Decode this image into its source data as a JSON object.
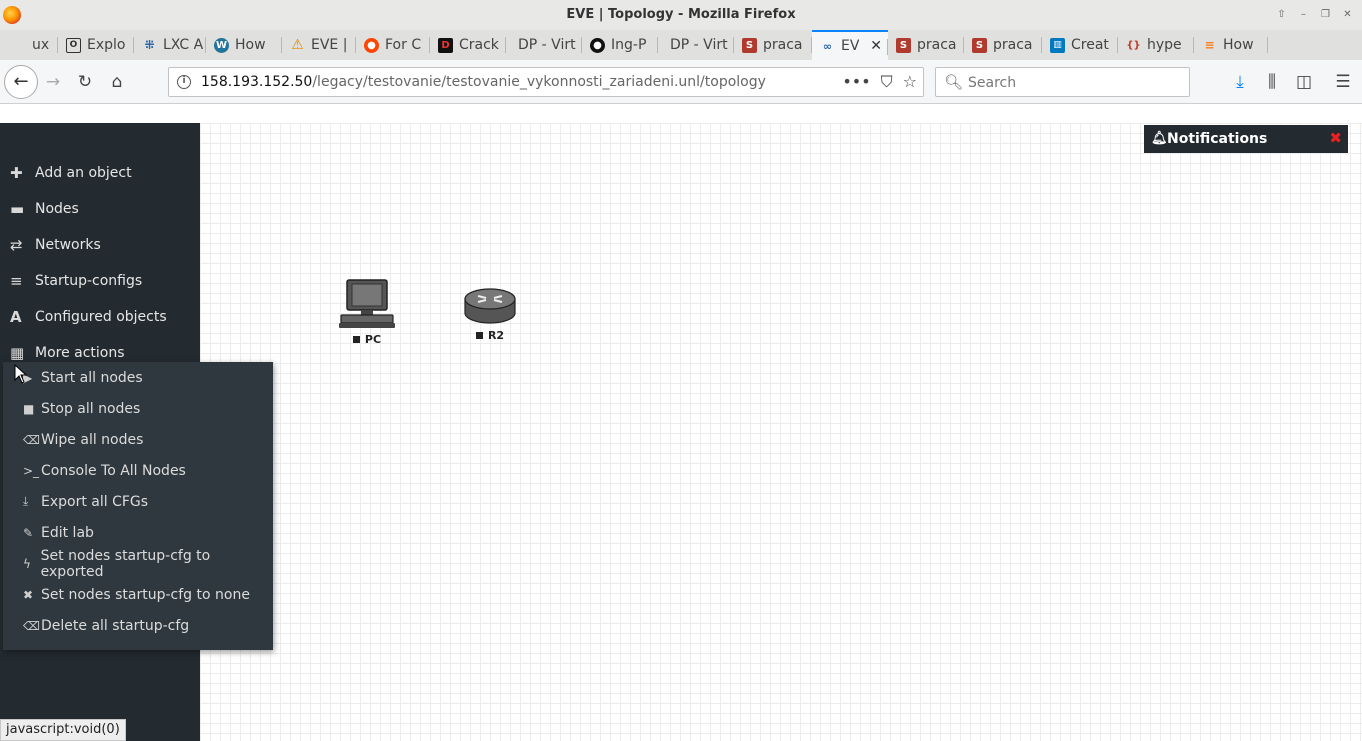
{
  "window": {
    "title": "EVE | Topology - Mozilla Firefox"
  },
  "tabs": [
    {
      "label": "ux",
      "icon": "generic-tab-icon"
    },
    {
      "label": "Explo",
      "icon": "o-logo-icon"
    },
    {
      "label": "LXC A",
      "icon": "grid-dots-icon"
    },
    {
      "label": "How",
      "icon": "wordpress-icon"
    },
    {
      "label": "EVE |",
      "icon": "warning-icon"
    },
    {
      "label": "For C",
      "icon": "reddit-icon"
    },
    {
      "label": "Crack",
      "icon": "d-logo-icon"
    },
    {
      "label": "DP - Virt",
      "icon": ""
    },
    {
      "label": "Ing-P",
      "icon": "github-icon"
    },
    {
      "label": "DP - Virt",
      "icon": ""
    },
    {
      "label": "praca",
      "icon": "s-logo-icon"
    },
    {
      "label": "EV",
      "icon": "eve-link-icon",
      "active": true
    },
    {
      "label": "praca",
      "icon": "s-logo-icon"
    },
    {
      "label": "praca",
      "icon": "s-logo-icon"
    },
    {
      "label": "Creat",
      "icon": "trello-icon"
    },
    {
      "label": "hype",
      "icon": "braces-icon"
    },
    {
      "label": "How",
      "icon": "stackoverflow-icon"
    }
  ],
  "address": {
    "host": "158.193.152.50",
    "path": "/legacy/testovanie/testovanie_vykonnosti_zariadeni.unl/topology"
  },
  "search": {
    "placeholder": "Search"
  },
  "sidebar": {
    "items": [
      {
        "label": "Add an object",
        "icon": "plus-icon"
      },
      {
        "label": "Nodes",
        "icon": "hdd-icon"
      },
      {
        "label": "Networks",
        "icon": "exchange-icon"
      },
      {
        "label": "Startup-configs",
        "icon": "align-left-icon"
      },
      {
        "label": "Configured objects",
        "icon": "font-a-icon"
      },
      {
        "label": "More actions",
        "icon": "grid-icon"
      }
    ]
  },
  "menu": {
    "items": [
      {
        "label": "Start all nodes",
        "icon": "play-icon"
      },
      {
        "label": "Stop all nodes",
        "icon": "stop-icon"
      },
      {
        "label": "Wipe all nodes",
        "icon": "eraser-icon"
      },
      {
        "label": "Console To All Nodes",
        "icon": "terminal-icon"
      },
      {
        "label": "Export all CFGs",
        "icon": "download-icon"
      },
      {
        "label": "Edit lab",
        "icon": "pencil-icon"
      },
      {
        "label": "Set nodes startup-cfg to exported",
        "icon": "bolt-icon"
      },
      {
        "label": "Set nodes startup-cfg to none",
        "icon": "times-icon"
      },
      {
        "label": "Delete all startup-cfg",
        "icon": "eraser-icon"
      }
    ]
  },
  "nodes": [
    {
      "name": "PC",
      "type": "pc-icon"
    },
    {
      "name": "R2",
      "type": "router-icon"
    }
  ],
  "notifications": {
    "title": "Notifications"
  },
  "status_bar": {
    "text": "javascript:void(0)"
  },
  "colors": {
    "sidebar_bg": "#232b30",
    "menu_bg": "#2e383e",
    "active_tab_accent": "#0a84ff",
    "notif_close": "#e82222"
  }
}
